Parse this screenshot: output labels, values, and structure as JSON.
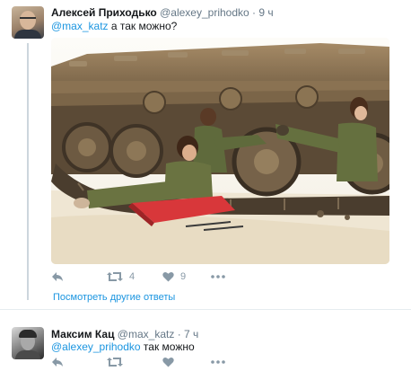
{
  "tweets": [
    {
      "name": "Алексей Приходько",
      "handle": "@alexey_prihodko",
      "separator": "·",
      "time": "9 ч",
      "mention": "@max_katz",
      "body": " а так можно?",
      "actions": {
        "retweets": "4",
        "likes": "9"
      }
    },
    {
      "name": "Максим Кац",
      "handle": "@max_katz",
      "separator": "·",
      "time": "7 ч",
      "mention": "@alexey_prihodko",
      "body": " так можно"
    }
  ],
  "more_replies_label": "Посмотреть другие ответы",
  "icons": [
    "reply-icon",
    "retweet-icon",
    "like-icon",
    "more-icon"
  ],
  "colors": {
    "link": "#1b95e0",
    "meta": "#657786",
    "icon": "#8899a6",
    "divider": "#e6ecf0"
  }
}
